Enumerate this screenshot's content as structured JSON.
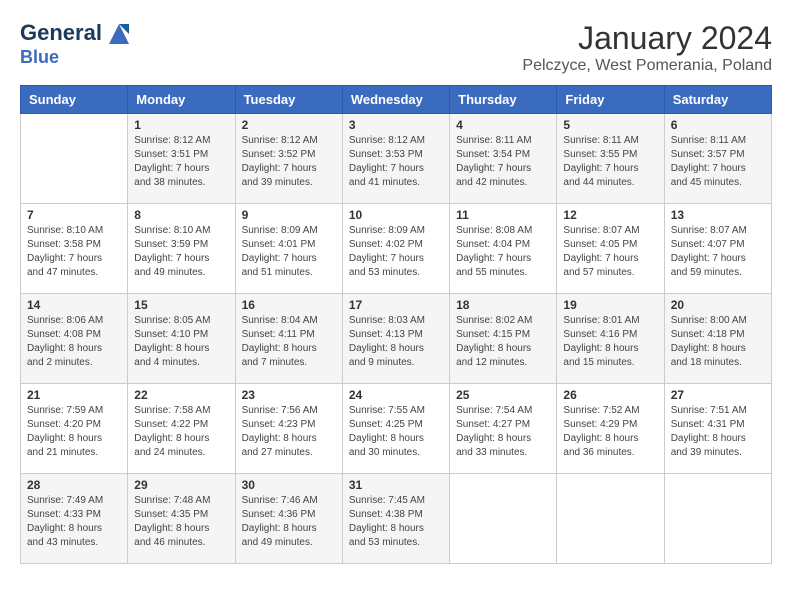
{
  "header": {
    "logo_line1": "General",
    "logo_line2": "Blue",
    "month": "January 2024",
    "location": "Pelczyce, West Pomerania, Poland"
  },
  "weekdays": [
    "Sunday",
    "Monday",
    "Tuesday",
    "Wednesday",
    "Thursday",
    "Friday",
    "Saturday"
  ],
  "weeks": [
    [
      {
        "day": "",
        "content": ""
      },
      {
        "day": "1",
        "content": "Sunrise: 8:12 AM\nSunset: 3:51 PM\nDaylight: 7 hours\nand 38 minutes."
      },
      {
        "day": "2",
        "content": "Sunrise: 8:12 AM\nSunset: 3:52 PM\nDaylight: 7 hours\nand 39 minutes."
      },
      {
        "day": "3",
        "content": "Sunrise: 8:12 AM\nSunset: 3:53 PM\nDaylight: 7 hours\nand 41 minutes."
      },
      {
        "day": "4",
        "content": "Sunrise: 8:11 AM\nSunset: 3:54 PM\nDaylight: 7 hours\nand 42 minutes."
      },
      {
        "day": "5",
        "content": "Sunrise: 8:11 AM\nSunset: 3:55 PM\nDaylight: 7 hours\nand 44 minutes."
      },
      {
        "day": "6",
        "content": "Sunrise: 8:11 AM\nSunset: 3:57 PM\nDaylight: 7 hours\nand 45 minutes."
      }
    ],
    [
      {
        "day": "7",
        "content": "Sunrise: 8:10 AM\nSunset: 3:58 PM\nDaylight: 7 hours\nand 47 minutes."
      },
      {
        "day": "8",
        "content": "Sunrise: 8:10 AM\nSunset: 3:59 PM\nDaylight: 7 hours\nand 49 minutes."
      },
      {
        "day": "9",
        "content": "Sunrise: 8:09 AM\nSunset: 4:01 PM\nDaylight: 7 hours\nand 51 minutes."
      },
      {
        "day": "10",
        "content": "Sunrise: 8:09 AM\nSunset: 4:02 PM\nDaylight: 7 hours\nand 53 minutes."
      },
      {
        "day": "11",
        "content": "Sunrise: 8:08 AM\nSunset: 4:04 PM\nDaylight: 7 hours\nand 55 minutes."
      },
      {
        "day": "12",
        "content": "Sunrise: 8:07 AM\nSunset: 4:05 PM\nDaylight: 7 hours\nand 57 minutes."
      },
      {
        "day": "13",
        "content": "Sunrise: 8:07 AM\nSunset: 4:07 PM\nDaylight: 7 hours\nand 59 minutes."
      }
    ],
    [
      {
        "day": "14",
        "content": "Sunrise: 8:06 AM\nSunset: 4:08 PM\nDaylight: 8 hours\nand 2 minutes."
      },
      {
        "day": "15",
        "content": "Sunrise: 8:05 AM\nSunset: 4:10 PM\nDaylight: 8 hours\nand 4 minutes."
      },
      {
        "day": "16",
        "content": "Sunrise: 8:04 AM\nSunset: 4:11 PM\nDaylight: 8 hours\nand 7 minutes."
      },
      {
        "day": "17",
        "content": "Sunrise: 8:03 AM\nSunset: 4:13 PM\nDaylight: 8 hours\nand 9 minutes."
      },
      {
        "day": "18",
        "content": "Sunrise: 8:02 AM\nSunset: 4:15 PM\nDaylight: 8 hours\nand 12 minutes."
      },
      {
        "day": "19",
        "content": "Sunrise: 8:01 AM\nSunset: 4:16 PM\nDaylight: 8 hours\nand 15 minutes."
      },
      {
        "day": "20",
        "content": "Sunrise: 8:00 AM\nSunset: 4:18 PM\nDaylight: 8 hours\nand 18 minutes."
      }
    ],
    [
      {
        "day": "21",
        "content": "Sunrise: 7:59 AM\nSunset: 4:20 PM\nDaylight: 8 hours\nand 21 minutes."
      },
      {
        "day": "22",
        "content": "Sunrise: 7:58 AM\nSunset: 4:22 PM\nDaylight: 8 hours\nand 24 minutes."
      },
      {
        "day": "23",
        "content": "Sunrise: 7:56 AM\nSunset: 4:23 PM\nDaylight: 8 hours\nand 27 minutes."
      },
      {
        "day": "24",
        "content": "Sunrise: 7:55 AM\nSunset: 4:25 PM\nDaylight: 8 hours\nand 30 minutes."
      },
      {
        "day": "25",
        "content": "Sunrise: 7:54 AM\nSunset: 4:27 PM\nDaylight: 8 hours\nand 33 minutes."
      },
      {
        "day": "26",
        "content": "Sunrise: 7:52 AM\nSunset: 4:29 PM\nDaylight: 8 hours\nand 36 minutes."
      },
      {
        "day": "27",
        "content": "Sunrise: 7:51 AM\nSunset: 4:31 PM\nDaylight: 8 hours\nand 39 minutes."
      }
    ],
    [
      {
        "day": "28",
        "content": "Sunrise: 7:49 AM\nSunset: 4:33 PM\nDaylight: 8 hours\nand 43 minutes."
      },
      {
        "day": "29",
        "content": "Sunrise: 7:48 AM\nSunset: 4:35 PM\nDaylight: 8 hours\nand 46 minutes."
      },
      {
        "day": "30",
        "content": "Sunrise: 7:46 AM\nSunset: 4:36 PM\nDaylight: 8 hours\nand 49 minutes."
      },
      {
        "day": "31",
        "content": "Sunrise: 7:45 AM\nSunset: 4:38 PM\nDaylight: 8 hours\nand 53 minutes."
      },
      {
        "day": "",
        "content": ""
      },
      {
        "day": "",
        "content": ""
      },
      {
        "day": "",
        "content": ""
      }
    ]
  ]
}
